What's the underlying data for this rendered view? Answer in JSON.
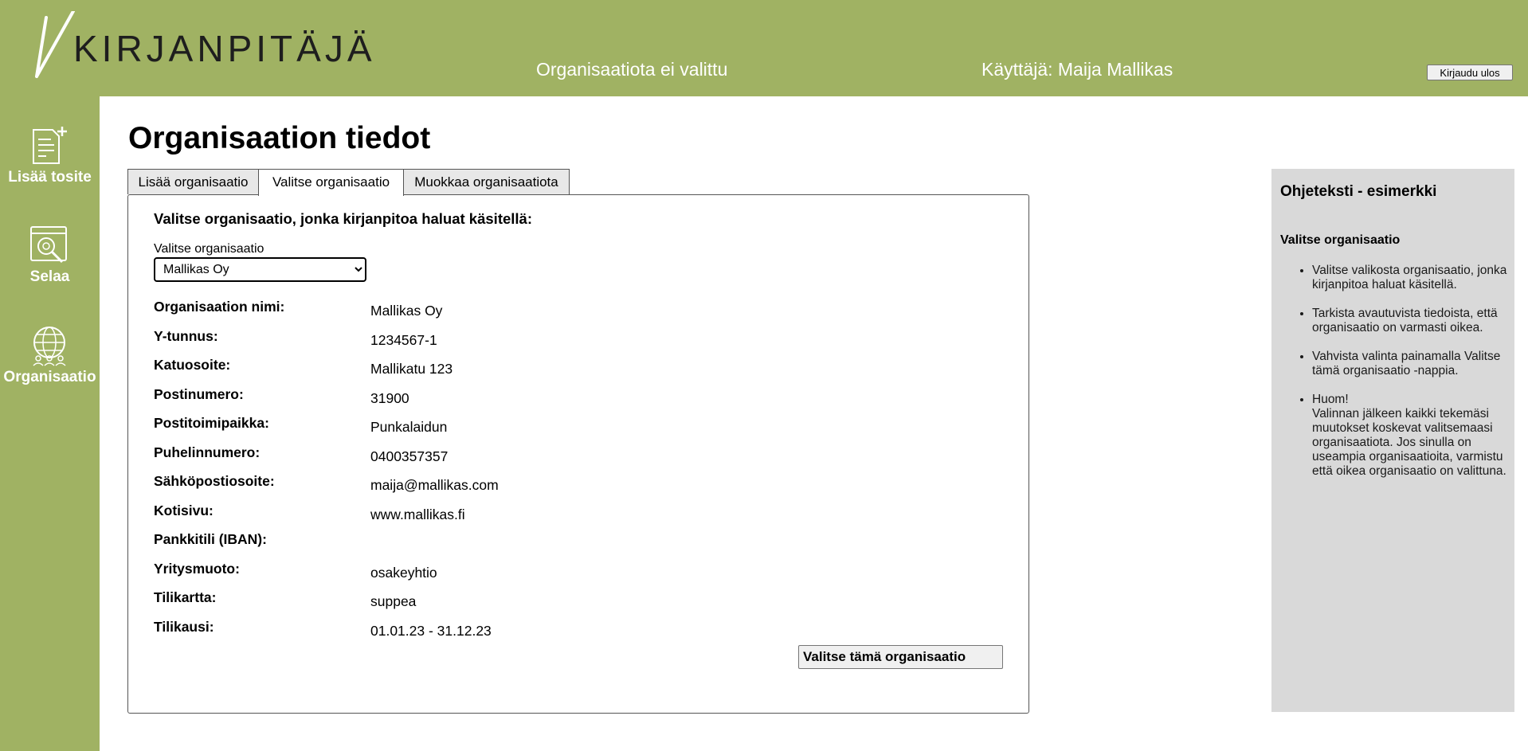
{
  "header": {
    "logo_text": "KIRJANPITÄJÄ",
    "org_status": "Organisaatiota ei valittu",
    "user": "Käyttäjä: Maija Mallikas",
    "logout_label": "Kirjaudu ulos"
  },
  "sidebar": {
    "items": [
      {
        "label": "Lisää tosite",
        "icon": "add-document-icon"
      },
      {
        "label": "Selaa",
        "icon": "browse-search-icon"
      },
      {
        "label": "Organisaatio",
        "icon": "organization-globe-icon"
      }
    ]
  },
  "main": {
    "title": "Organisaation tiedot",
    "tabs": [
      {
        "label": "Lisää organisaatio",
        "active": false
      },
      {
        "label": "Valitse organisaatio",
        "active": true
      },
      {
        "label": "Muokkaa organisaatiota",
        "active": false
      }
    ],
    "heading": "Valitse organisaatio, jonka kirjanpitoa haluat käsitellä:",
    "select_label": "Valitse organisaatio",
    "select_value": "Mallikas Oy",
    "fields": [
      {
        "label": "Organisaation nimi:",
        "value": "Mallikas Oy"
      },
      {
        "label": "Y-tunnus:",
        "value": "1234567-1"
      },
      {
        "label": "Katuosoite:",
        "value": "Mallikatu 123"
      },
      {
        "label": "Postinumero:",
        "value": "31900"
      },
      {
        "label": "Postitoimipaikka:",
        "value": "Punkalaidun"
      },
      {
        "label": "Puhelinnumero:",
        "value": "0400357357"
      },
      {
        "label": "Sähköpostiosoite:",
        "value": "maija@mallikas.com"
      },
      {
        "label": "Kotisivu:",
        "value": "www.mallikas.fi"
      },
      {
        "label": "Pankkitili (IBAN):",
        "value": ""
      },
      {
        "label": "Yritysmuoto:",
        "value": "osakeyhtio"
      },
      {
        "label": "Tilikartta:",
        "value": "suppea"
      },
      {
        "label": "Tilikausi:",
        "value": "01.01.23 - 31.12.23"
      }
    ],
    "confirm_label": "Valitse tämä organisaatio"
  },
  "help": {
    "title": "Ohjeteksti - esimerkki",
    "subtitle": "Valitse organisaatio",
    "items": [
      "Valitse valikosta organisaatio, jonka kirjanpitoa haluat käsitellä.",
      "Tarkista avautuvista tiedoista, että organisaatio on varmasti oikea.",
      "Vahvista valinta painamalla Valitse tämä organisaatio -nappia.",
      "Huom!",
      "Valinnan jälkeen kaikki tekemäsi muutokset koskevat valitsemaasi organisaatiota. Jos sinulla on useampia organisaatioita, varmistu että oikea organisaatio on valittuna."
    ]
  },
  "colors": {
    "brand_green": "#a0b263",
    "help_bg": "#d9d9d9"
  }
}
